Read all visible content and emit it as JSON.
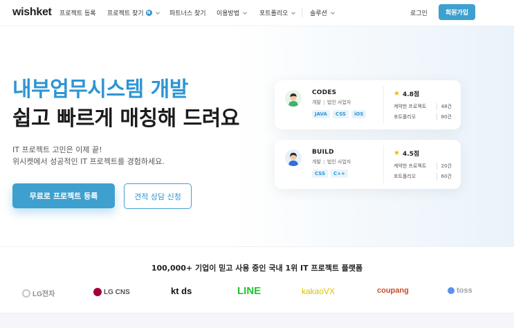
{
  "nav": {
    "logo": "wishket",
    "items": [
      {
        "label": "프로젝트 등록"
      },
      {
        "label": "프로젝트 찾기",
        "badge": "N"
      },
      {
        "label": "파트너스 찾기"
      },
      {
        "label": "이용방법"
      },
      {
        "label": "포트폴리오"
      },
      {
        "label": "솔루션"
      }
    ],
    "login": "로그인",
    "signup": "회원가입"
  },
  "hero": {
    "title_line1": "내부업무시스템 개발",
    "title_line2": "쉽고 빠르게 매칭해 드려요",
    "sub_line1": "IT 프로젝트 고민은 이제 끝!",
    "sub_line2": "위시켓에서 성공적인 IT 프로젝트를 경험하세요.",
    "cta_primary": "무료로 프로젝트 등록",
    "cta_secondary": "견적 상담 신청"
  },
  "cards": [
    {
      "name": "CODES",
      "role": "개발",
      "type": "법인 사업자",
      "tags": [
        "JAVA",
        "CSS",
        "iOS"
      ],
      "rating": "4.8점",
      "contracts_label": "계약한 프로젝트",
      "contracts_value": "48건",
      "portfolio_label": "포트폴리오",
      "portfolio_value": "80건"
    },
    {
      "name": "BUILD",
      "role": "개발",
      "type": "법인 사업자",
      "tags": [
        "CSS",
        "C++"
      ],
      "rating": "4.5점",
      "contracts_label": "계약한 프로젝트",
      "contracts_value": "20건",
      "portfolio_label": "포트폴리오",
      "portfolio_value": "60건"
    }
  ],
  "trust": {
    "headline": "100,000+ 기업이 믿고 사용 중인 국내 1위 IT 프로젝트 플랫폼",
    "brands": [
      "LG전자",
      "LG CNS",
      "kt ds",
      "LINE",
      "kakaoVX",
      "coupang",
      "toss"
    ]
  },
  "colors": {
    "accent": "#2e95d3",
    "button": "#3ea0cf",
    "star": "#f2b60a"
  }
}
